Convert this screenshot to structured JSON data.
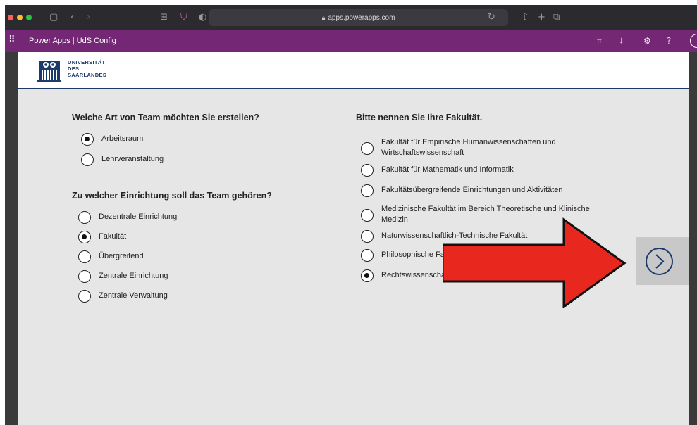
{
  "browser": {
    "url": "apps.powerapps.com",
    "colors": {
      "chrome": "#2b2a2f",
      "close": "#fe5f57",
      "minimize": "#febc2e",
      "maximize": "#28c840"
    }
  },
  "app_header": {
    "title": "Power Apps  |  UdS Config",
    "color": "#742774"
  },
  "university": {
    "name_lines": [
      "UNIVERSITÄT",
      "DES",
      "SAARLANDES"
    ],
    "color": "#1b3a6b"
  },
  "team_type": {
    "question": "Welche Art von Team möchten Sie erstellen?",
    "options": [
      {
        "label": "Arbeitsraum",
        "selected": true
      },
      {
        "label": "Lehrveranstaltung",
        "selected": false
      }
    ]
  },
  "institution": {
    "question": "Zu welcher Einrichtung soll das Team gehören?",
    "options": [
      {
        "label": "Dezentrale Einrichtung",
        "selected": false
      },
      {
        "label": "Fakultät",
        "selected": true
      },
      {
        "label": "Übergreifend",
        "selected": false
      },
      {
        "label": "Zentrale Einrichtung",
        "selected": false
      },
      {
        "label": "Zentrale Verwaltung",
        "selected": false
      }
    ]
  },
  "faculty": {
    "question": "Bitte nennen Sie Ihre Fakultät.",
    "options": [
      {
        "label": "Fakultät für Empirische Humanwissenschaften und Wirtschaftswissenschaft",
        "selected": false
      },
      {
        "label": "Fakultät für Mathematik und Informatik",
        "selected": false
      },
      {
        "label": "Fakultätsübergreifende Einrichtungen und Aktivitäten",
        "selected": false
      },
      {
        "label": "Medizinische Fakultät im Bereich Theoretische und Klinische Medizin",
        "selected": false
      },
      {
        "label": "Naturwissenschaftlich-Technische Fakultät",
        "selected": false
      },
      {
        "label": "Philosophische Fa",
        "selected": false
      },
      {
        "label": "Rechtswissenscha",
        "selected": true
      }
    ]
  },
  "next_button": {
    "icon": "chevron-right-circle-icon"
  },
  "overlay": {
    "arrow_color": "#e8281e"
  }
}
